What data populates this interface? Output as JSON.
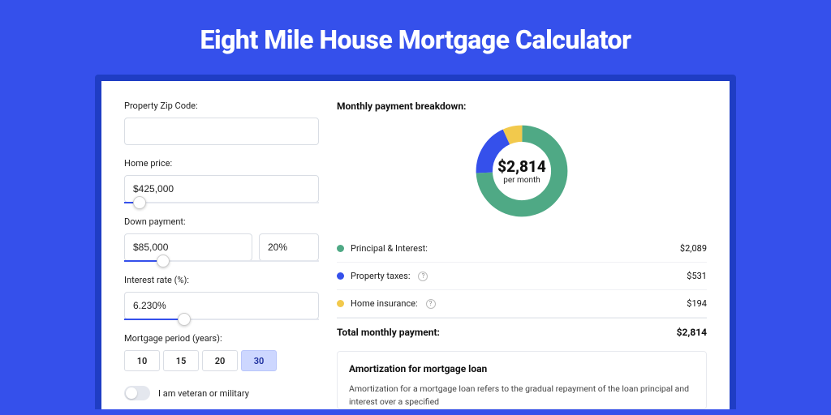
{
  "title": "Eight Mile House Mortgage Calculator",
  "form": {
    "zip": {
      "label": "Property Zip Code:",
      "value": ""
    },
    "home_price": {
      "label": "Home price:",
      "value": "$425,000",
      "slider_pct": 8
    },
    "down_payment": {
      "label": "Down payment:",
      "amount": "$85,000",
      "percent": "20%",
      "slider_pct": 20
    },
    "interest_rate": {
      "label": "Interest rate (%):",
      "value": "6.230%",
      "slider_pct": 31
    },
    "mortgage_period": {
      "label": "Mortgage period (years):",
      "options": [
        "10",
        "15",
        "20",
        "30"
      ],
      "selected": "30"
    },
    "veteran": {
      "label": "I am veteran or military"
    }
  },
  "breakdown": {
    "title": "Monthly payment breakdown:",
    "center_amount": "$2,814",
    "center_sub": "per month",
    "items": [
      {
        "label": "Principal & Interest:",
        "value": "$2,089",
        "color": "#4fa985",
        "help": false
      },
      {
        "label": "Property taxes:",
        "value": "$531",
        "color": "#3550eb",
        "help": true
      },
      {
        "label": "Home insurance:",
        "value": "$194",
        "color": "#f2c94c",
        "help": true
      }
    ],
    "total_label": "Total monthly payment:",
    "total_value": "$2,814"
  },
  "amortization": {
    "title": "Amortization for mortgage loan",
    "text": "Amortization for a mortgage loan refers to the gradual repayment of the loan principal and interest over a specified"
  },
  "chart_data": {
    "type": "pie",
    "title": "Monthly payment breakdown",
    "total": 2814,
    "series": [
      {
        "name": "Principal & Interest",
        "value": 2089,
        "color": "#4fa985"
      },
      {
        "name": "Property taxes",
        "value": 531,
        "color": "#3550eb"
      },
      {
        "name": "Home insurance",
        "value": 194,
        "color": "#f2c94c"
      }
    ]
  }
}
